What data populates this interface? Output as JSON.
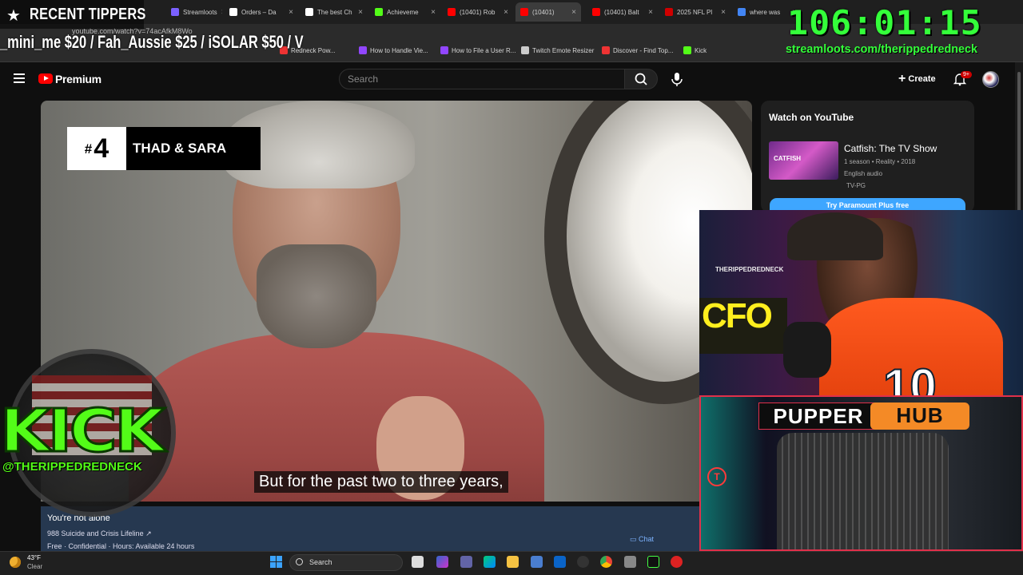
{
  "browser": {
    "tabs": [
      {
        "label": "Streamloots",
        "color": "#7b61ff"
      },
      {
        "label": "Orders – Da",
        "color": "#ffffff"
      },
      {
        "label": "The best Ch",
        "color": "#ffffff"
      },
      {
        "label": "Achieveme",
        "color": "#53fc18"
      },
      {
        "label": "(10401) Rob",
        "color": "#ff0000"
      },
      {
        "label": "(10401)",
        "color": "#ff0000",
        "active": true
      },
      {
        "label": "(10401) Balt",
        "color": "#ff0000"
      },
      {
        "label": "2025 NFL Pl",
        "color": "#d00000"
      },
      {
        "label": "where was",
        "color": "#4285f4"
      }
    ],
    "url": "youtube.com/watch?v=74acAfkM8Wo",
    "bookmarks": [
      {
        "label": "Redneck Pow...",
        "color": "#e33"
      },
      {
        "label": "How to Handle Vie...",
        "color": "#9146ff"
      },
      {
        "label": "How to File a User R...",
        "color": "#9146ff"
      },
      {
        "label": "Twitch Emote Resizer",
        "color": "#cccccc"
      },
      {
        "label": "Discover - Find Top...",
        "color": "#e33"
      },
      {
        "label": "Kick",
        "color": "#53fc18"
      }
    ]
  },
  "overlay": {
    "tippers_title": "RECENT TIPPERS",
    "ticker": "_mini_me $20 / Fah_Aussie $25 / iSOLAR $50 / V",
    "timer": "106:01:15",
    "streamloots": "streamloots.com/therippedredneck",
    "kick_logo": "KICK",
    "kick_handle": "@THERIPPEDREDNECK",
    "pupper_a": "PUPPER",
    "pupper_b": "HUB",
    "cam_sign": "CFO",
    "cam_neon": "THERIPPEDREDNECK",
    "cam_number": "10"
  },
  "youtube": {
    "brand": "Premium",
    "search_placeholder": "Search",
    "create_label": "Create",
    "notif_count": "9+"
  },
  "video": {
    "rank_number": "4",
    "rank_hash": "#",
    "rank_name": "THAD & SARA",
    "caption": "But for the past two to three years,"
  },
  "crisis": {
    "title": "You're not alone",
    "line": "988 Suicide and Crisis Lifeline ↗",
    "hours": "Free · Confidential · Hours: Available 24 hours",
    "chat": "Chat"
  },
  "side": {
    "title": "Watch on YouTube",
    "thumb_text": "CATFISH",
    "show_title": "Catfish: The TV Show",
    "show_meta": "1 season • Reality • 2018",
    "show_lang": "English audio",
    "show_rating": "TV-PG",
    "try_label": "Try Paramount Plus free"
  },
  "taskbar": {
    "temp": "43°F",
    "cond": "Clear",
    "search": "Search"
  }
}
